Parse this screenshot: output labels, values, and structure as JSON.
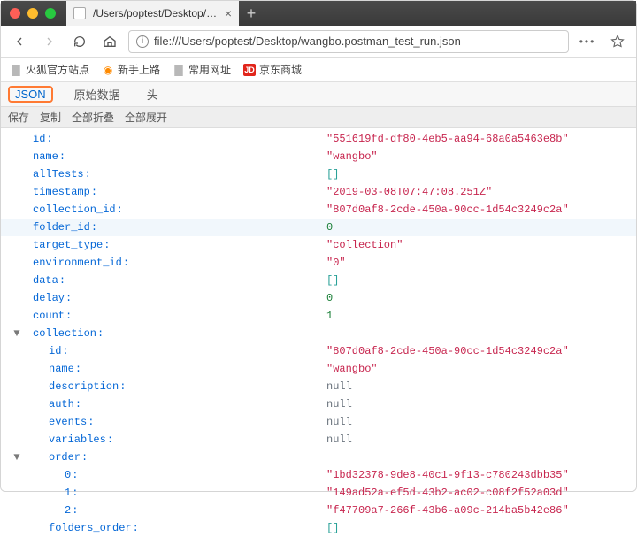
{
  "window": {
    "tab_title": "/Users/poptest/Desktop/wangbo.p",
    "url": "file:///Users/poptest/Desktop/wangbo.postman_test_run.json"
  },
  "bookmarks": {
    "firefox_sites": "火狐官方站点",
    "getting_started": "新手上路",
    "common_urls": "常用网址",
    "jd_mall": "京东商城",
    "jd_badge": "JD"
  },
  "viewtabs": {
    "json": "JSON",
    "raw": "原始数据",
    "headers": "头"
  },
  "toolbar": {
    "save": "保存",
    "copy": "复制",
    "collapse_all": "全部折叠",
    "expand_all": "全部展开"
  },
  "json_rows": [
    {
      "depth": 0,
      "gutter": "",
      "key": "id",
      "vclass": "str",
      "value": "\"551619fd-df80-4eb5-aa94-68a0a5463e8b\""
    },
    {
      "depth": 0,
      "gutter": "",
      "key": "name",
      "vclass": "str",
      "value": "\"wangbo\""
    },
    {
      "depth": 0,
      "gutter": "",
      "key": "allTests",
      "vclass": "brk",
      "value": "[]"
    },
    {
      "depth": 0,
      "gutter": "",
      "key": "timestamp",
      "vclass": "str",
      "value": "\"2019-03-08T07:47:08.251Z\""
    },
    {
      "depth": 0,
      "gutter": "",
      "key": "collection_id",
      "vclass": "str",
      "value": "\"807d0af8-2cde-450a-90cc-1d54c3249c2a\""
    },
    {
      "depth": 0,
      "gutter": "",
      "key": "folder_id",
      "vclass": "num",
      "value": "0",
      "hi": true
    },
    {
      "depth": 0,
      "gutter": "",
      "key": "target_type",
      "vclass": "str",
      "value": "\"collection\""
    },
    {
      "depth": 0,
      "gutter": "",
      "key": "environment_id",
      "vclass": "str",
      "value": "\"0\""
    },
    {
      "depth": 0,
      "gutter": "",
      "key": "data",
      "vclass": "brk",
      "value": "[]"
    },
    {
      "depth": 0,
      "gutter": "",
      "key": "delay",
      "vclass": "num",
      "value": "0"
    },
    {
      "depth": 0,
      "gutter": "",
      "key": "count",
      "vclass": "num",
      "value": "1"
    },
    {
      "depth": 0,
      "gutter": "▼",
      "key": "collection",
      "vclass": "",
      "value": ""
    },
    {
      "depth": 1,
      "gutter": "",
      "key": "id",
      "vclass": "str",
      "value": "\"807d0af8-2cde-450a-90cc-1d54c3249c2a\""
    },
    {
      "depth": 1,
      "gutter": "",
      "key": "name",
      "vclass": "str",
      "value": "\"wangbo\""
    },
    {
      "depth": 1,
      "gutter": "",
      "key": "description",
      "vclass": "nul",
      "value": "null"
    },
    {
      "depth": 1,
      "gutter": "",
      "key": "auth",
      "vclass": "nul",
      "value": "null"
    },
    {
      "depth": 1,
      "gutter": "",
      "key": "events",
      "vclass": "nul",
      "value": "null"
    },
    {
      "depth": 1,
      "gutter": "",
      "key": "variables",
      "vclass": "nul",
      "value": "null"
    },
    {
      "depth": 1,
      "gutter": "▼",
      "key": "order",
      "vclass": "",
      "value": ""
    },
    {
      "depth": 2,
      "gutter": "",
      "key": "0",
      "vclass": "str",
      "value": "\"1bd32378-9de8-40c1-9f13-c780243dbb35\""
    },
    {
      "depth": 2,
      "gutter": "",
      "key": "1",
      "vclass": "str",
      "value": "\"149ad52a-ef5d-43b2-ac02-c08f2f52a03d\""
    },
    {
      "depth": 2,
      "gutter": "",
      "key": "2",
      "vclass": "str",
      "value": "\"f47709a7-266f-43b6-a09c-214ba5b42e86\""
    },
    {
      "depth": 1,
      "gutter": "",
      "key": "folders_order",
      "vclass": "brk",
      "value": "[]"
    }
  ]
}
